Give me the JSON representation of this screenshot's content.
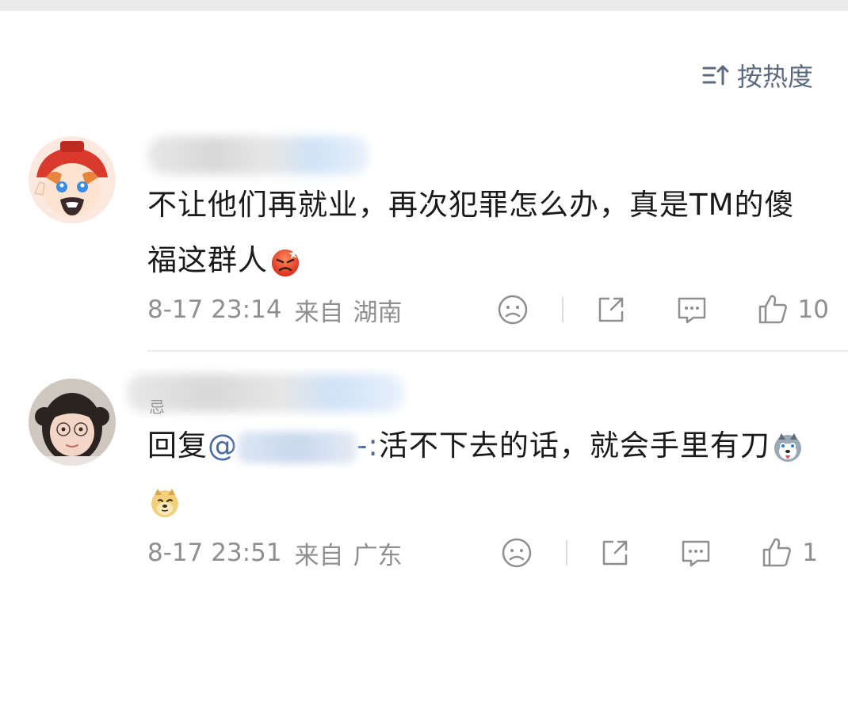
{
  "sort": {
    "label": "按热度",
    "icon": "sort-icon"
  },
  "comments": [
    {
      "text": "不让他们再就业，再次犯罪怎么办，真是TM的傻福这群人",
      "emoji": "angry-emoji",
      "time": "8-17 23:14",
      "from": "来自",
      "location": "湖南",
      "likes": "10"
    },
    {
      "name_fragment": "忌",
      "reply_prefix": "回复",
      "mention_start": "@",
      "mention_tail": "-:",
      "text": "活不下去的话，就会手里有刀",
      "emojis": [
        "husky-emoji",
        "doge-emoji"
      ],
      "time": "8-17 23:51",
      "from": "来自",
      "location": "广东",
      "likes": "1"
    }
  ],
  "colors": {
    "link": "#4a6aa0",
    "meta": "#8f8f8f",
    "sort": "#5c6b80",
    "divider": "#ececec"
  }
}
